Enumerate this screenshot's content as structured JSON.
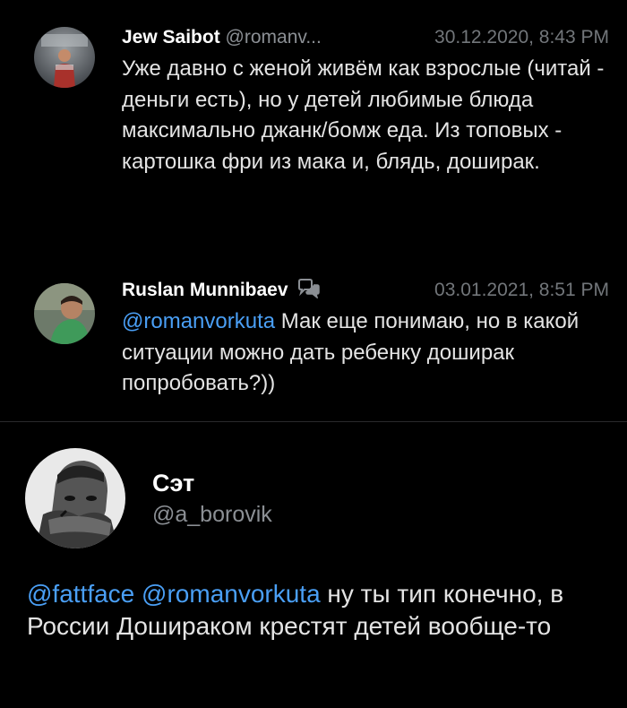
{
  "comments": [
    {
      "name": "Jew Saibot",
      "handle": "@romanv...",
      "date": "30.12.2020, 8:43 PM",
      "text": "Уже давно с женой живём как взрослые (читай - деньги есть), но у детей любимые блюда максимально джанк/бомж еда. Из топовых - картошка фри из мака и, блядь, доширак."
    },
    {
      "name": "Ruslan Munnibaev",
      "badge_icon": "chat-bubbles-icon",
      "date": "03.01.2021, 8:51 PM",
      "mention": "@romanvorkuta",
      "text": " Мак еще понимаю, но в какой ситуации можно дать ребенку доширак попробовать?))"
    }
  ],
  "main_tweet": {
    "name": "Сэт",
    "handle": "@a_borovik",
    "mention1": "@fattface",
    "mention2": "@romanvorkuta",
    "text": " ну ты тип конечно, в России Дошираком крестят детей вообще-то"
  },
  "colors": {
    "background": "#000000",
    "mention": "#4a9ff5",
    "secondary_text": "#8b8f94"
  }
}
